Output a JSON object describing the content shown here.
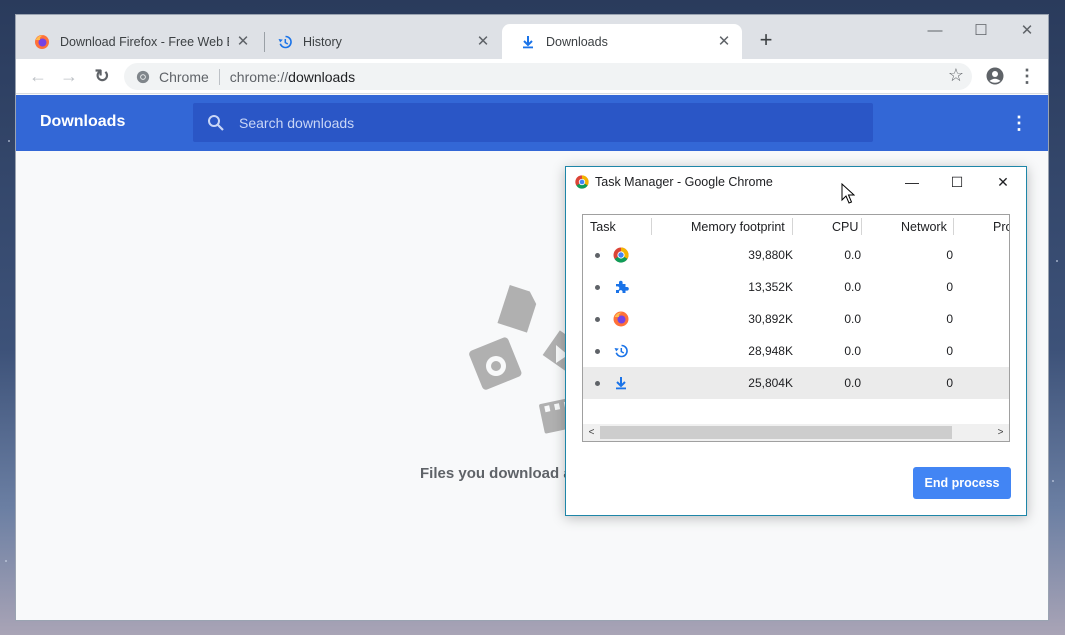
{
  "browser": {
    "tabs": [
      {
        "title": "Download Firefox - Free Web Bro",
        "icon": "firefox-icon",
        "active": false
      },
      {
        "title": "History",
        "icon": "history-icon",
        "active": false
      },
      {
        "title": "Downloads",
        "icon": "download-icon",
        "active": true
      }
    ],
    "tab_close_glyph": "✕",
    "new_tab_glyph": "+",
    "window_controls": {
      "minimize": "—",
      "maximize": "☐",
      "close": "✕"
    },
    "nav": {
      "back": "←",
      "forward": "→",
      "reload": "↻"
    },
    "omnibox": {
      "site_label": "Chrome",
      "url_scheme": "chrome://",
      "url_path": "downloads"
    },
    "bookmark_glyph": "☆",
    "menu_glyph": "⋮"
  },
  "downloads_page": {
    "title": "Downloads",
    "search_placeholder": "Search downloads",
    "menu_glyph": "⋮",
    "empty_message": "Files you download a"
  },
  "task_manager": {
    "title": "Task Manager - Google Chrome",
    "controls": {
      "minimize": "—",
      "maximize": "☐",
      "close": "✕"
    },
    "columns": [
      "Task",
      "Memory footprint",
      "CPU",
      "Network",
      "Pro"
    ],
    "rows": [
      {
        "icon": "chrome-icon",
        "memory": "39,880K",
        "cpu": "0.0",
        "network": "0"
      },
      {
        "icon": "extension-icon",
        "memory": "13,352K",
        "cpu": "0.0",
        "network": "0"
      },
      {
        "icon": "firefox-icon",
        "memory": "30,892K",
        "cpu": "0.0",
        "network": "0"
      },
      {
        "icon": "history-icon",
        "memory": "28,948K",
        "cpu": "0.0",
        "network": "0"
      },
      {
        "icon": "download-icon",
        "memory": "25,804K",
        "cpu": "0.0",
        "network": "0"
      }
    ],
    "selected_row": 4,
    "scroll_left_glyph": "<",
    "scroll_right_glyph": ">",
    "end_process_label": "End process"
  },
  "colors": {
    "header_blue": "#3367d6",
    "search_blue": "#2a56c6",
    "button_blue": "#4285f4",
    "task_manager_border": "#1e86a8"
  }
}
